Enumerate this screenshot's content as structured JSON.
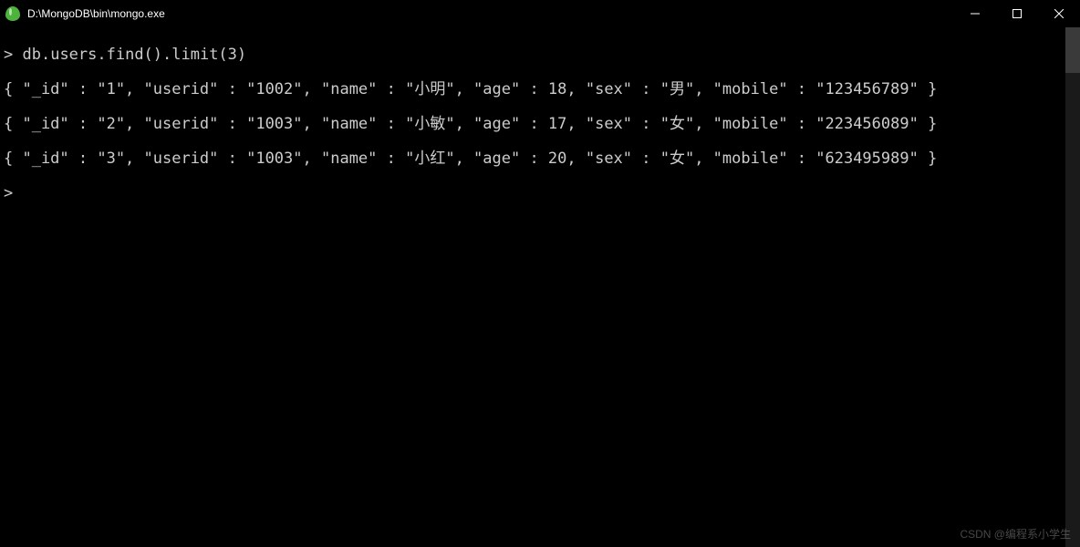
{
  "window": {
    "title": "D:\\MongoDB\\bin\\mongo.exe"
  },
  "terminal": {
    "prompt": ">",
    "command": "db.users.find().limit(3)",
    "lines": [
      "{ \"_id\" : \"1\", \"userid\" : \"1002\", \"name\" : \"小明\", \"age\" : 18, \"sex\" : \"男\", \"mobile\" : \"123456789\" }",
      "{ \"_id\" : \"2\", \"userid\" : \"1003\", \"name\" : \"小敏\", \"age\" : 17, \"sex\" : \"女\", \"mobile\" : \"223456089\" }",
      "{ \"_id\" : \"3\", \"userid\" : \"1003\", \"name\" : \"小红\", \"age\" : 20, \"sex\" : \"女\", \"mobile\" : \"623495989\" }"
    ],
    "cursor_prompt": ">"
  },
  "watermark": "CSDN @编程系小学生"
}
